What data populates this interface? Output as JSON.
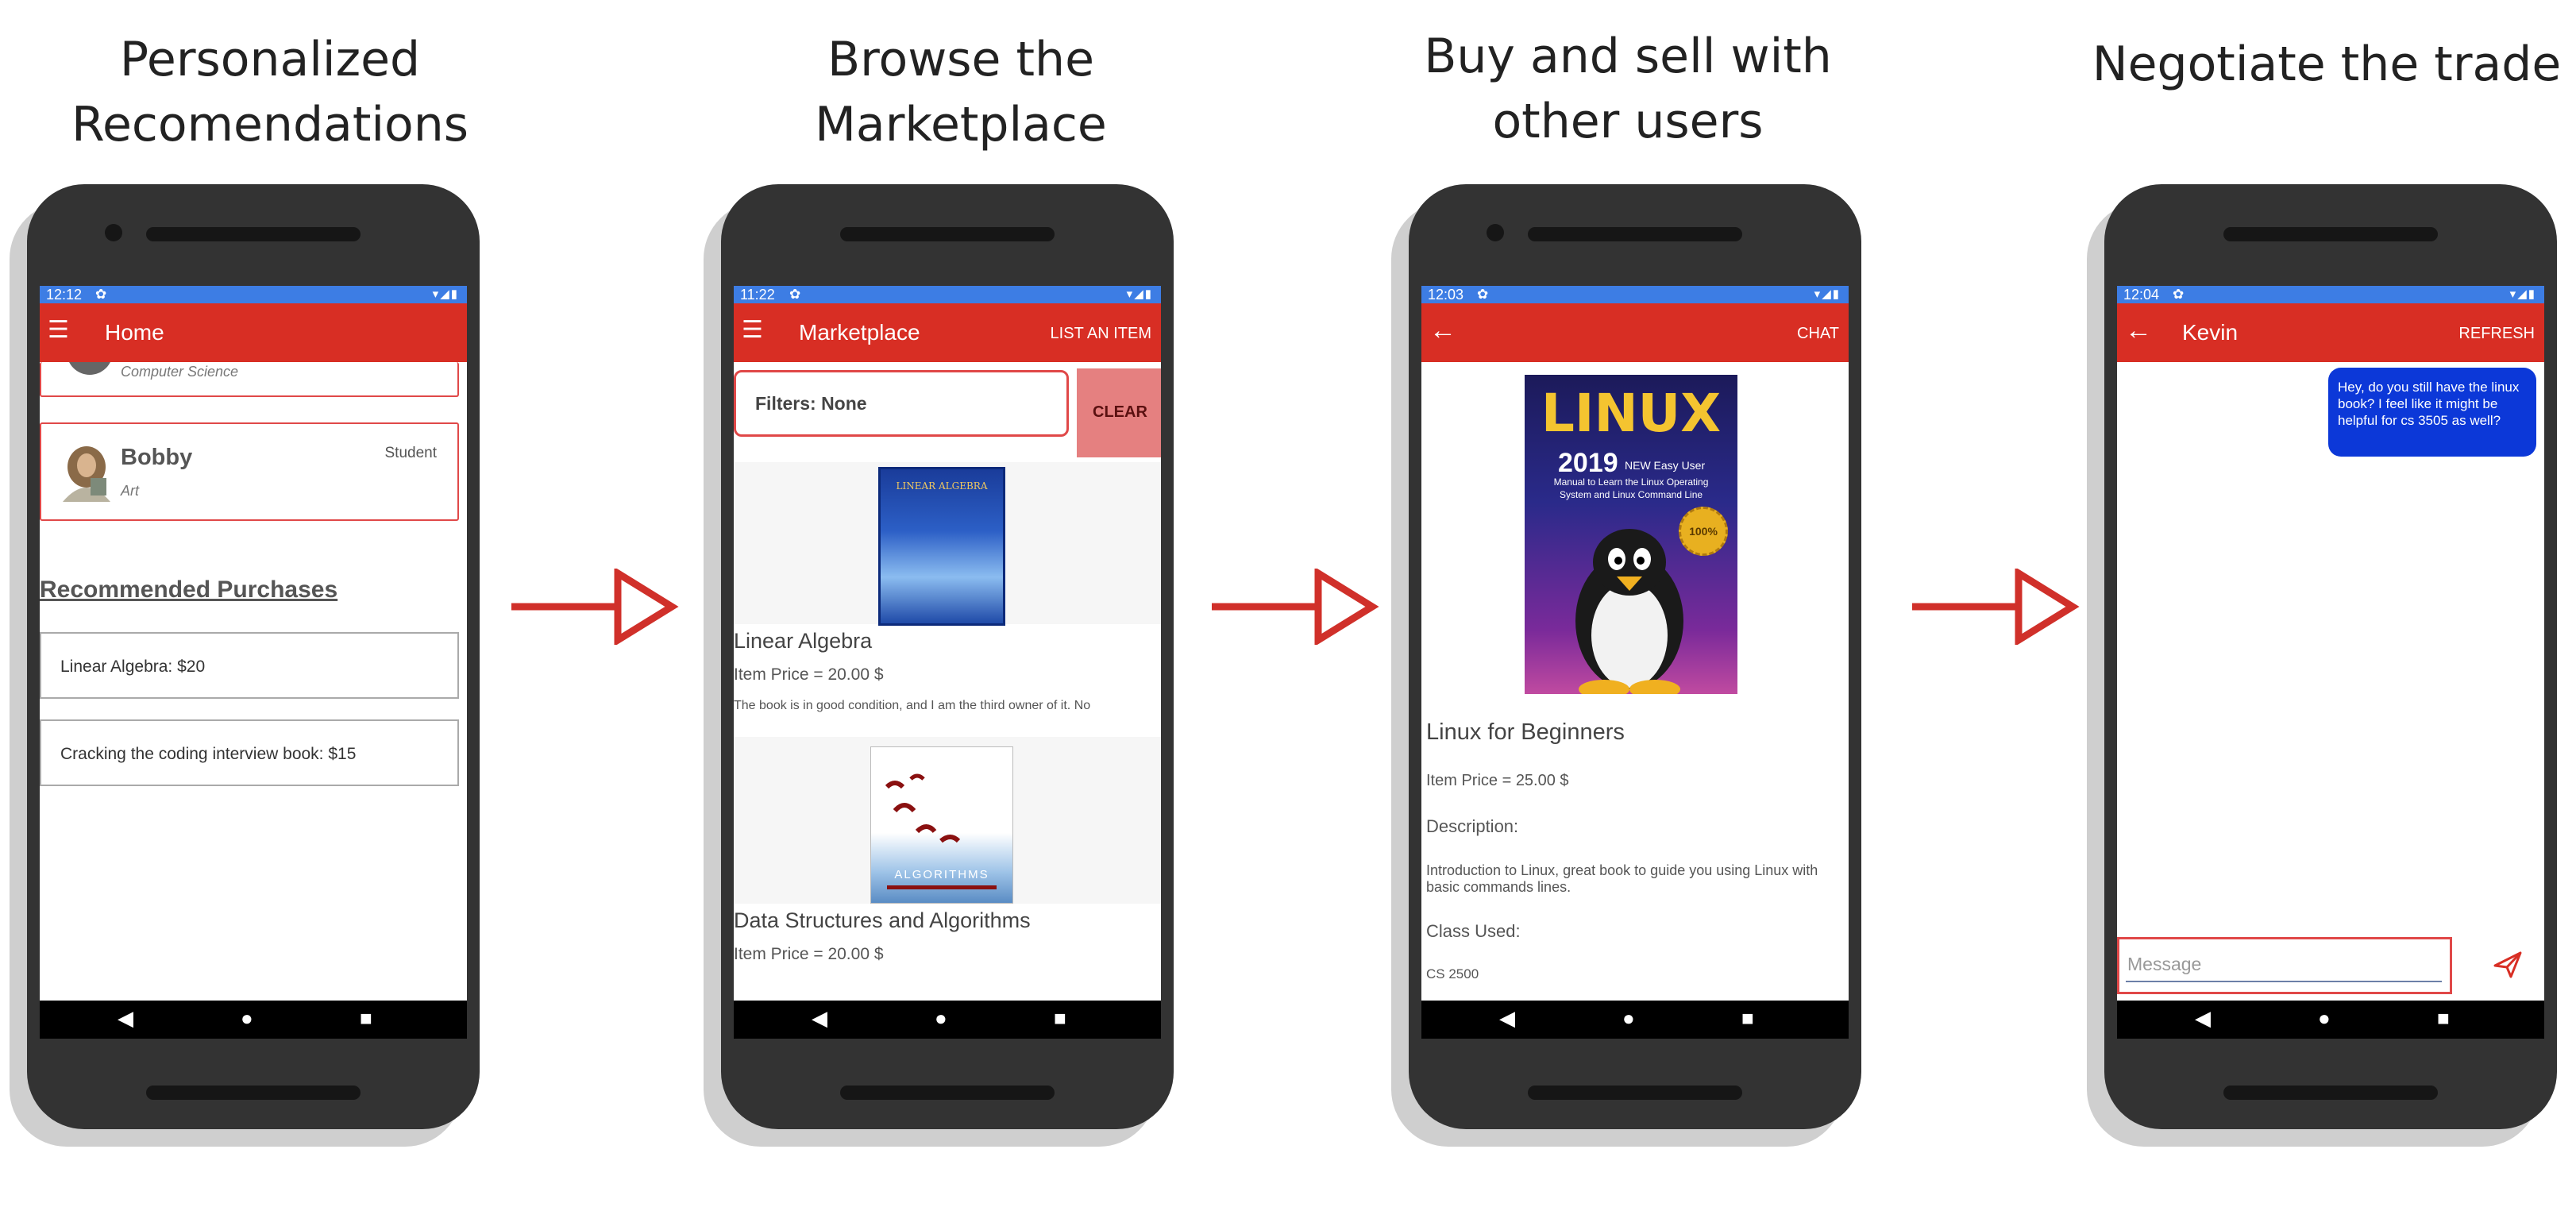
{
  "captions": [
    {
      "line1": "Personalized",
      "line2": "Recomendations"
    },
    {
      "line1": "Browse the Marketplace",
      "line2": ""
    },
    {
      "line1": "Buy and sell with",
      "line2": "other users"
    },
    {
      "line1": "Negotiate the trade",
      "line2": ""
    }
  ],
  "colors": {
    "appbar": "#d82e24",
    "statusbar": "#3d7de4",
    "arrow": "#d0302a",
    "bubble": "#0c38d8",
    "phone": "#333333"
  },
  "icons": {
    "menu": "menu-icon",
    "back": "back-arrow-icon",
    "send": "send-icon",
    "settings": "gear-icon"
  },
  "statusbar": {
    "icons": "▾◢▮"
  },
  "navbar": {
    "back": "◀",
    "home": "●",
    "recents": "■"
  },
  "screens": {
    "home": {
      "time": "12:12",
      "title": "Home",
      "partial_card_subtitle": "Computer Science",
      "user": {
        "name": "Bobby",
        "role": "Student",
        "major": "Art"
      },
      "section_title": "Recommended Purchases",
      "recommendations": [
        "Linear Algebra: $20",
        "Cracking the coding interview book: $15"
      ]
    },
    "market": {
      "time": "11:22",
      "title": "Marketplace",
      "action": "LIST AN ITEM",
      "filters": "Filters: None",
      "clear": "CLEAR",
      "listings": [
        {
          "title": "Linear Algebra",
          "price": "Item Price = 20.00 $",
          "desc": "The book is in good condition, and I am the third owner of it. No",
          "cover_title": "LINEAR ALGEBRA"
        },
        {
          "title": "Data Structures and Algorithms",
          "price": "Item Price = 20.00 $",
          "cover_title": "ALGORITHMS"
        }
      ]
    },
    "detail": {
      "time": "12:03",
      "action": "CHAT",
      "cover": {
        "word": "LINUX",
        "year": "2019",
        "tag": "NEW Easy User",
        "sub1": "Manual to Learn the Linux Operating",
        "sub2": "System and Linux Command Line",
        "seal": "100%"
      },
      "title": "Linux for Beginners",
      "price": "Item Price = 25.00 $",
      "desc_label": "Description:",
      "desc": "Introduction to Linux, great book to guide you using Linux with basic commands lines.",
      "class_label": "Class Used:",
      "class_value": "CS 2500"
    },
    "chat": {
      "time": "12:04",
      "title": "Kevin",
      "action": "REFRESH",
      "message": "Hey, do you still have the linux book? I feel like it might be helpful for cs 3505 as well?",
      "placeholder": "Message"
    }
  }
}
